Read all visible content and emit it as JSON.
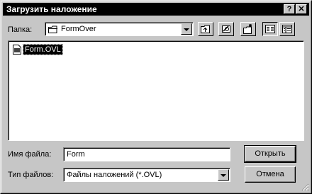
{
  "window": {
    "title": "Загрузить наложение",
    "help_label": "?",
    "close_label": "✕"
  },
  "folder": {
    "label": "Папка:",
    "value": "FormOver"
  },
  "toolbar": {
    "icons": [
      "up-folder-icon",
      "desktop-icon",
      "new-folder-icon",
      "list-view-icon",
      "details-view-icon"
    ]
  },
  "files": [
    {
      "name": "Form.OVL",
      "selected": true
    }
  ],
  "filename": {
    "label": "Имя файла:",
    "value": "Form"
  },
  "filetype": {
    "label": "Тип файлов:",
    "value": "Файлы наложений (*.OVL)"
  },
  "buttons": {
    "open": "Открыть",
    "cancel": "Отмена"
  }
}
